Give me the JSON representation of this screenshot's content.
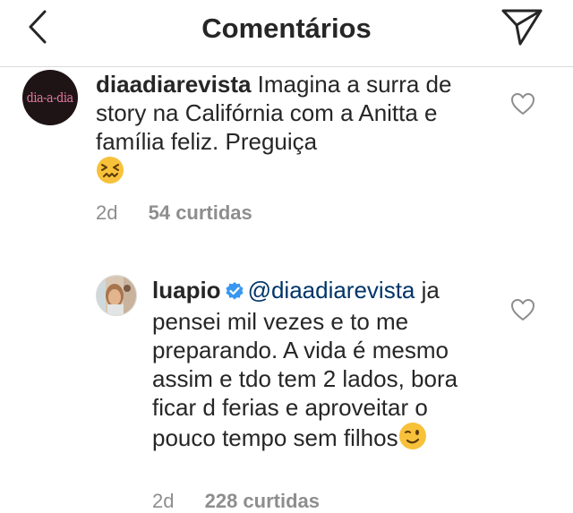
{
  "header": {
    "title": "Comentários",
    "back_icon": "chevron-left-icon",
    "send_icon": "paper-plane-icon"
  },
  "comments": [
    {
      "username": "diaadiarevista",
      "avatar_text": "dia-a-dia",
      "text": "Imagina a surra de story na Califórnia com a Anitta e família feliz. Preguiça",
      "emoji": "confounded-face-emoji",
      "time": "2d",
      "likes": "54 curtidas"
    },
    {
      "username": "luapio",
      "verified": true,
      "mention": "@diaadiarevista",
      "text": "ja pensei mil vezes e to me preparando. A vida é mesmo assim e tdo tem 2 lados, bora ficar d ferias e aproveitar o pouco tempo sem filhos",
      "emoji": "winking-face-emoji",
      "time": "2d",
      "likes": "228 curtidas"
    }
  ],
  "colors": {
    "text": "#262626",
    "secondary": "#8e8e8e",
    "mention": "#003569",
    "verified": "#3897f0",
    "border": "#dbdbdb"
  }
}
